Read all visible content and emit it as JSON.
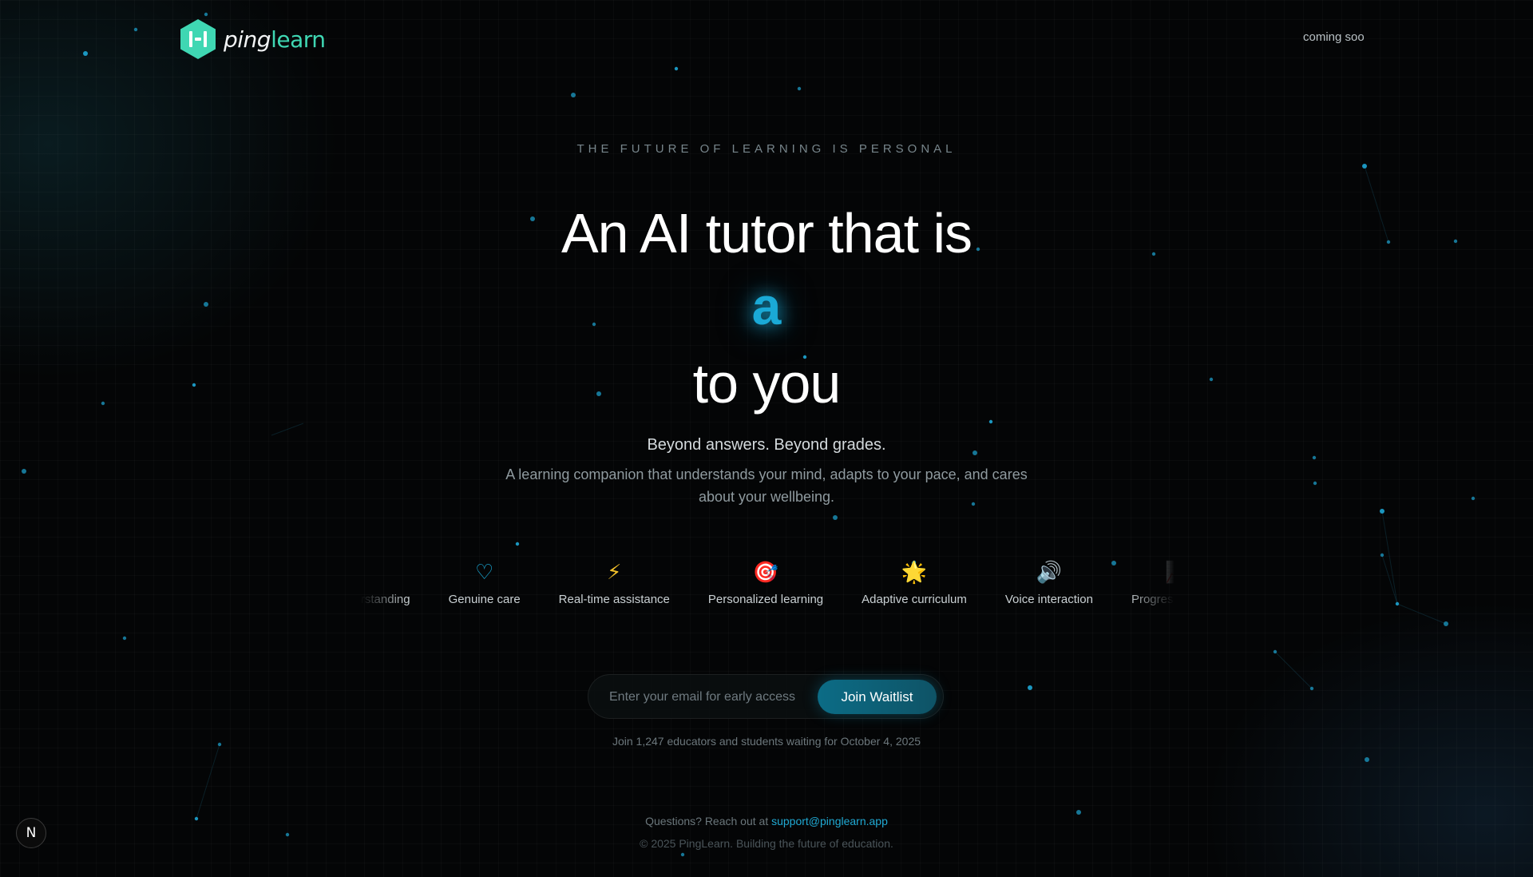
{
  "header": {
    "logo_ping": "ping",
    "logo_learn": "learn",
    "coming_soon": "coming soo"
  },
  "hero": {
    "eyebrow": "THE FUTURE OF LEARNING IS PERSONAL",
    "headline_top": "An AI tutor that is",
    "rotating_word": "a",
    "headline_bottom": "to you",
    "tagline": "Beyond answers. Beyond grades.",
    "description": "A learning companion that understands your mind, adapts to your pace, and cares about your wellbeing."
  },
  "features": [
    {
      "icon": "target-dot-icon",
      "glyph": "◉",
      "label": "Intimate understanding",
      "color": "#1aa9d6"
    },
    {
      "icon": "heart-icon",
      "glyph": "♡",
      "label": "Genuine care",
      "color": "#1aa9d6"
    },
    {
      "icon": "lightning-icon",
      "glyph": "⚡",
      "label": "Real-time assistance",
      "color": "#f2c02a"
    },
    {
      "icon": "bullseye-icon",
      "glyph": "🎯",
      "label": "Personalized learning",
      "color": "#e0483b"
    },
    {
      "icon": "star-icon",
      "glyph": "🌟",
      "label": "Adaptive curriculum",
      "color": "#f4c542"
    },
    {
      "icon": "speaker-icon",
      "glyph": "🔊",
      "label": "Voice interaction",
      "color": "#9aa4a9"
    },
    {
      "icon": "progress-icon",
      "glyph": "📈",
      "label": "Progress tracking",
      "color": "#9aa4a9"
    }
  ],
  "signup": {
    "email_placeholder": "Enter your email for early access",
    "join_label": "Join Waitlist",
    "note": "Join 1,247 educators and students waiting for October 4, 2025"
  },
  "footer": {
    "contact_prefix": "Questions? Reach out at",
    "contact_email": "support@pinglearn.app",
    "copyright": "© 2025 PingLearn. Building the future of education.",
    "badge_letter": "N"
  },
  "colors": {
    "accent": "#1aa9d6",
    "brand_green": "#3fd7b3",
    "background": "#040506"
  }
}
